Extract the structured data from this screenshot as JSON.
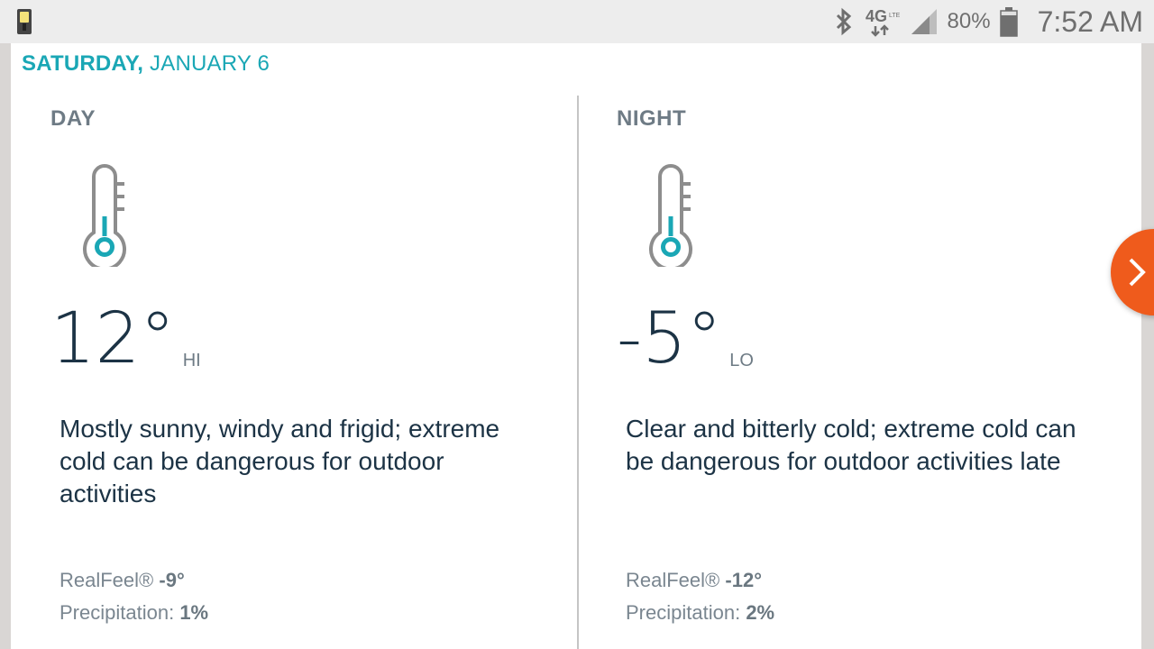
{
  "status_bar": {
    "network": "4G LTE",
    "battery": "80%",
    "time": "7:52 AM",
    "icons": [
      "flashlight-icon",
      "bluetooth-icon",
      "lte-icon",
      "signal-icon",
      "battery-icon"
    ]
  },
  "date": {
    "weekday": "SATURDAY,",
    "month_day": "JANUARY 6"
  },
  "day": {
    "label": "DAY",
    "temp": "12°",
    "tag": "HI",
    "phrase": "Mostly sunny, windy and frigid; extreme cold can be dangerous for outdoor activities",
    "realfeel_label": "RealFeel®",
    "realfeel_value": "-9°",
    "precip_label": "Precipitation:",
    "precip_value": "1%"
  },
  "night": {
    "label": "NIGHT",
    "temp": "-5°",
    "tag": "LO",
    "phrase": "Clear and bitterly cold; extreme cold can be dangerous for outdoor activities late",
    "realfeel_label": "RealFeel®",
    "realfeel_value": "-12°",
    "precip_label": "Precipitation:",
    "precip_value": "2%"
  },
  "colors": {
    "accent": "#1aa7b5",
    "next": "#ef5b1c",
    "text": "#1c3345",
    "muted": "#6e7b85"
  }
}
